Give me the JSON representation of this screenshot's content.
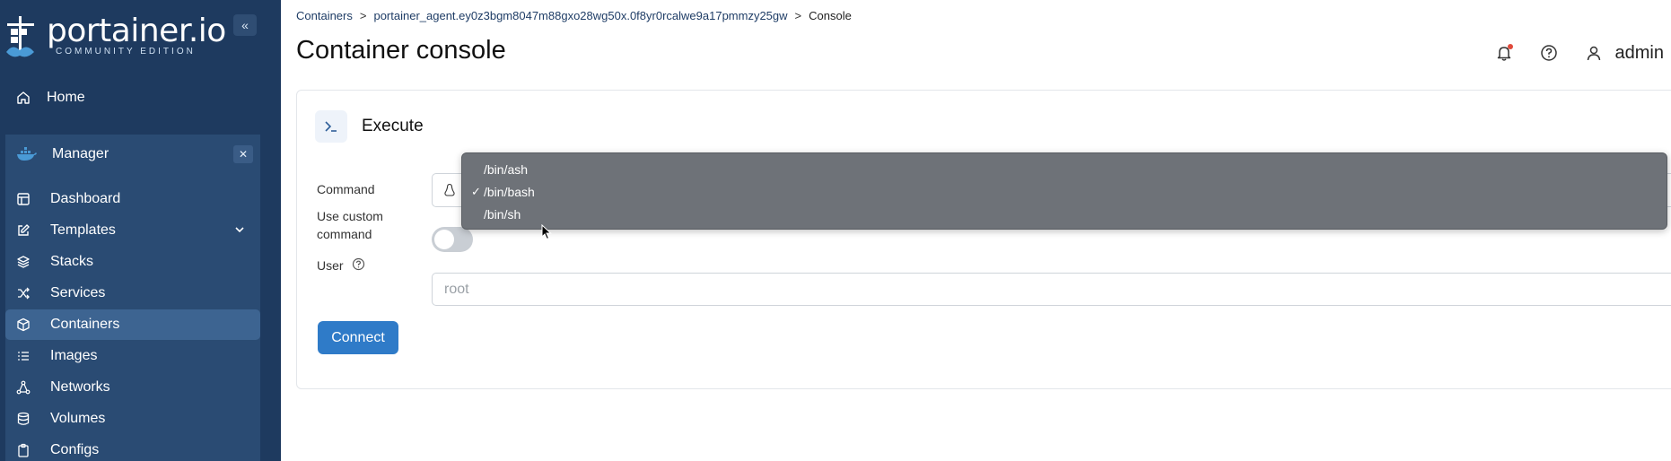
{
  "brand": {
    "name": "portainer.io",
    "edition": "COMMUNITY EDITION",
    "accent": "#1e3a5f"
  },
  "sidebar": {
    "collapse_icon": "double-chevron-left-icon",
    "home": {
      "label": "Home",
      "icon": "home-icon"
    },
    "environment": {
      "name": "Manager",
      "icon": "docker-whale-icon",
      "close_icon": "close-icon"
    },
    "items": [
      {
        "label": "Dashboard",
        "icon": "dashboard-icon"
      },
      {
        "label": "Templates",
        "icon": "edit-icon",
        "has_chevron": true
      },
      {
        "label": "Stacks",
        "icon": "layers-icon"
      },
      {
        "label": "Services",
        "icon": "shuffle-icon"
      },
      {
        "label": "Containers",
        "icon": "box-icon",
        "active": true
      },
      {
        "label": "Images",
        "icon": "list-icon"
      },
      {
        "label": "Networks",
        "icon": "network-icon"
      },
      {
        "label": "Volumes",
        "icon": "database-icon"
      },
      {
        "label": "Configs",
        "icon": "clipboard-icon"
      }
    ]
  },
  "breadcrumb": {
    "items": [
      "Containers",
      "portainer_agent.ey0z3bgm8047m88gxo28wg50x.0f8yr0rcalwe9a17pmmzy25gw",
      "Console"
    ],
    "separator": ">"
  },
  "header": {
    "title": "Container console",
    "user": "admin",
    "icons": [
      "bell-icon",
      "help-icon",
      "user-icon"
    ]
  },
  "panel": {
    "title": "Execute",
    "command_label": "Command",
    "custom_label": "Use custom command",
    "custom_enabled": false,
    "user_label": "User",
    "user_placeholder": "root",
    "connect_label": "Connect"
  },
  "dropdown": {
    "options": [
      "/bin/ash",
      "/bin/bash",
      "/bin/sh"
    ],
    "selected": "/bin/bash",
    "check_mark": "✓"
  }
}
